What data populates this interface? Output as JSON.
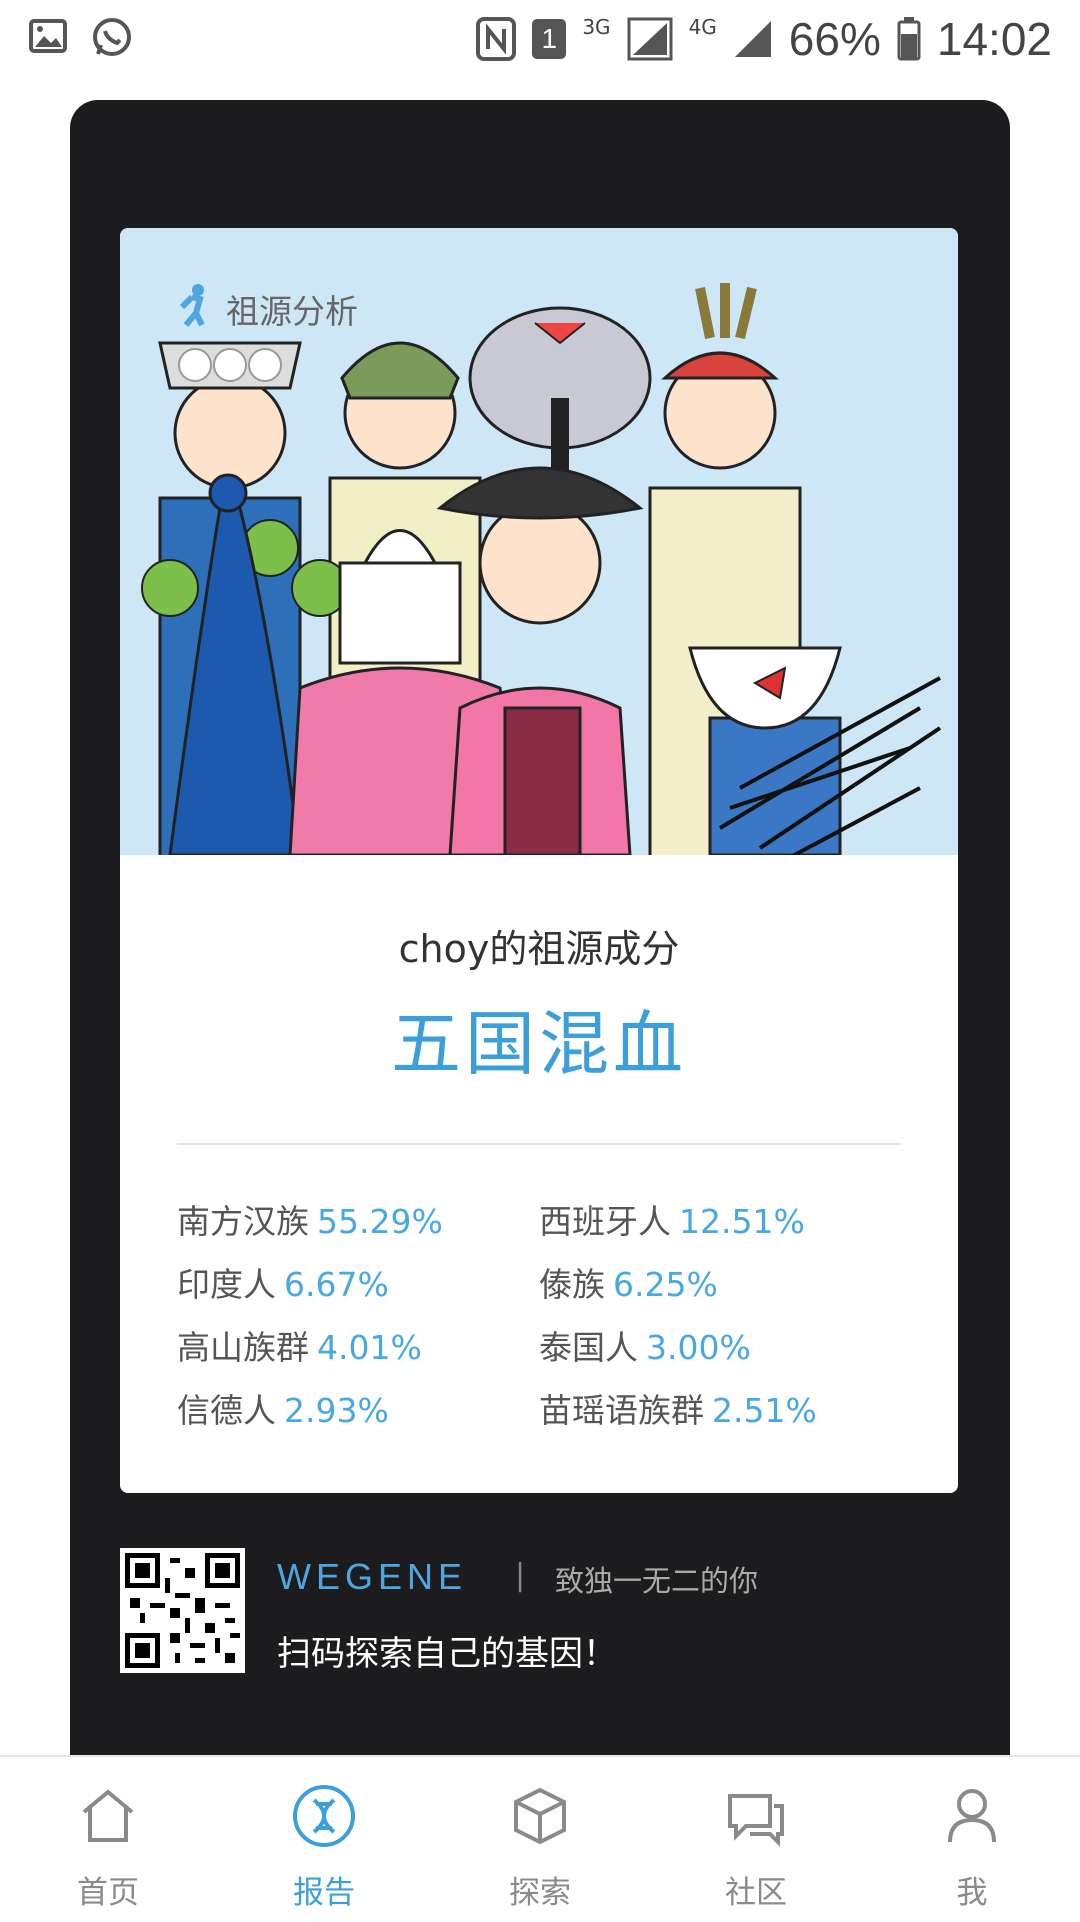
{
  "status_bar": {
    "network_3g": "3G",
    "network_4g": "4G",
    "notification_count": "1",
    "battery": "66%",
    "time": "14:02"
  },
  "report": {
    "module_title": "祖源分析",
    "subtitle": "choy的祖源成分",
    "result": "五国混血",
    "ancestry": [
      {
        "name": "南方汉族",
        "percent": "55.29%"
      },
      {
        "name": "西班牙人",
        "percent": "12.51%"
      },
      {
        "name": "印度人",
        "percent": "6.67%"
      },
      {
        "name": "傣族",
        "percent": "6.25%"
      },
      {
        "name": "高山族群",
        "percent": "4.01%"
      },
      {
        "name": "泰国人",
        "percent": "3.00%"
      },
      {
        "name": "信德人",
        "percent": "2.93%"
      },
      {
        "name": "苗瑶语族群",
        "percent": "2.51%"
      }
    ]
  },
  "branding": {
    "brand": "WEGENE",
    "separator": "|",
    "slogan": "致独一无二的你",
    "cta": "扫码探索自己的基因！"
  },
  "nav": [
    {
      "label": "首页",
      "icon": "home-icon"
    },
    {
      "label": "报告",
      "icon": "dna-report-icon"
    },
    {
      "label": "探索",
      "icon": "cube-icon"
    },
    {
      "label": "社区",
      "icon": "chat-icon"
    },
    {
      "label": "我",
      "icon": "user-icon"
    }
  ],
  "colors": {
    "accent": "#3b9fdc",
    "card_dark": "#1c1c1e",
    "illustration_bg": "#cde7f7"
  }
}
